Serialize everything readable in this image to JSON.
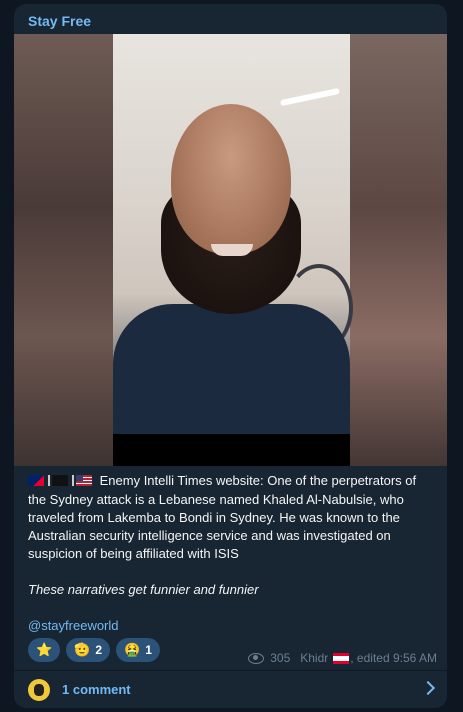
{
  "channel": {
    "name": "Stay Free"
  },
  "post": {
    "flags": [
      "australia-flag",
      "pirate-flag",
      "us-flag"
    ],
    "paragraph1": "Enemy Intelli Times website: One of the perpetrators of the Sydney attack is a Lebanese named Khaled Al-Nabulsie, who traveled from Lakemba to Bondi in Sydney. He was known to the Australian security intelligence service and was investigated on suspicion of being affiliated with ISIS",
    "paragraph2": "These narratives get funnier and funnier",
    "link": "@stayfreeworld"
  },
  "reactions": [
    {
      "emoji": "⭐",
      "icon": "star-icon",
      "count": ""
    },
    {
      "emoji": "🫡",
      "icon": "salute-hand-icon",
      "count": "2"
    },
    {
      "emoji": "🤮",
      "icon": "vomit-face-icon",
      "count": "1"
    }
  ],
  "meta": {
    "views": "305",
    "author": "Khidr",
    "edited": ", edited 9:56 AM"
  },
  "comments": {
    "label": "1 comment"
  },
  "colors": {
    "accent": "#71baf5",
    "bubble": "#182533",
    "background": "#0e1621",
    "reaction_bg": "#2b5278"
  }
}
